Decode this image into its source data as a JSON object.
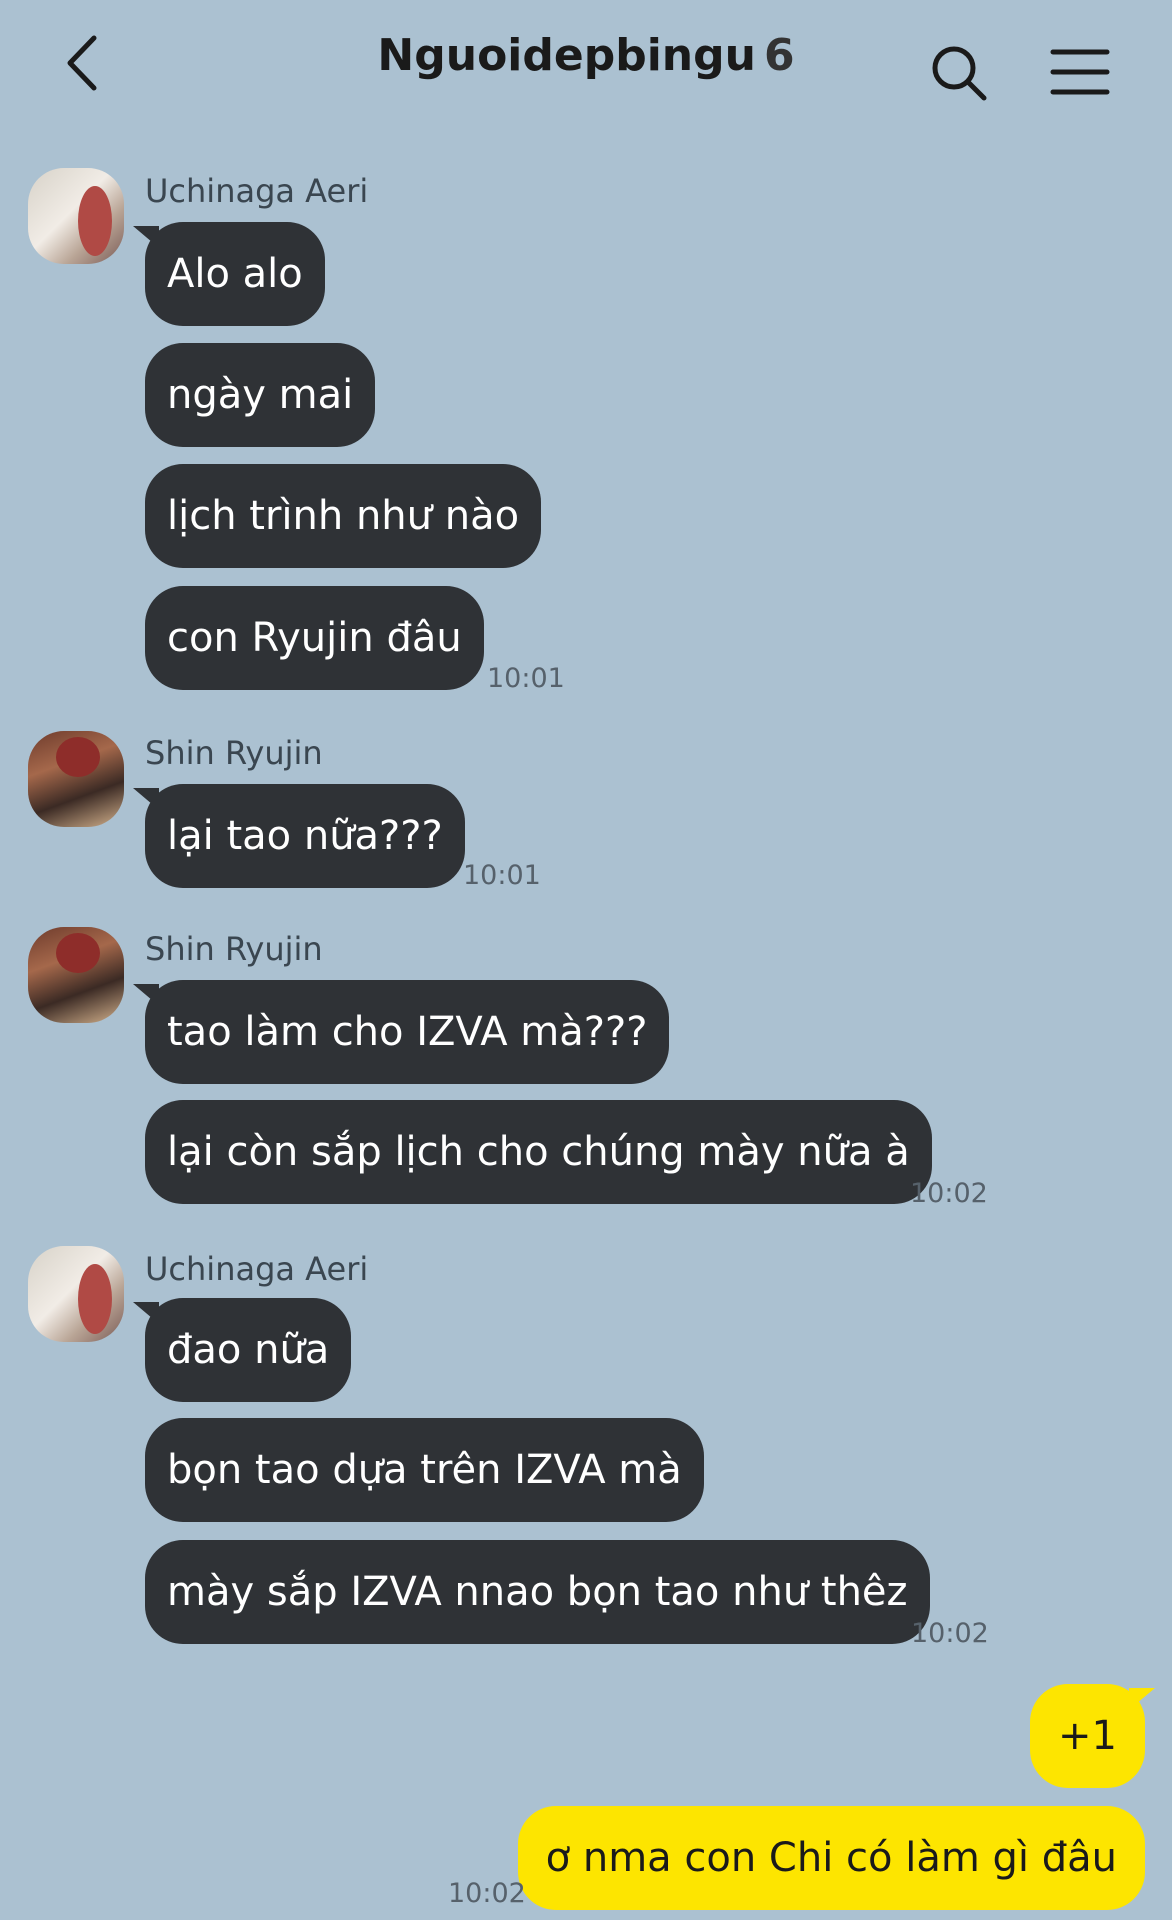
{
  "header": {
    "title": "Nguoidepbingu",
    "member_count": "6",
    "back_icon": "chevron-left-icon",
    "search_icon": "search-icon",
    "menu_icon": "menu-icon"
  },
  "colors": {
    "background": "#abc1d1",
    "incoming_bubble": "#2f3236",
    "outgoing_bubble": "#fde500"
  },
  "messages": [
    {
      "sender": "Uchinaga Aeri",
      "avatar": "aeri",
      "bubbles": [
        "Alo alo",
        "ngày mai",
        "lịch trình như nào",
        "con Ryujin đâu"
      ],
      "time": "10:01"
    },
    {
      "sender": "Shin Ryujin",
      "avatar": "ryujin",
      "bubbles": [
        "lại tao nữa???"
      ],
      "time": "10:01"
    },
    {
      "sender": "Shin Ryujin",
      "avatar": "ryujin",
      "bubbles": [
        "tao làm cho IZVA mà???",
        "lại còn sắp lịch cho chúng mày nữa à"
      ],
      "time": "10:02"
    },
    {
      "sender": "Uchinaga Aeri",
      "avatar": "aeri",
      "bubbles": [
        "đao nữa",
        "bọn tao dựa trên IZVA mà",
        "mày sắp IZVA nnao bọn tao như thêz"
      ],
      "time": "10:02"
    }
  ],
  "my_messages": {
    "bubbles": [
      "+1",
      "ơ nma con Chi có làm gì đâu"
    ],
    "time": "10:02"
  }
}
